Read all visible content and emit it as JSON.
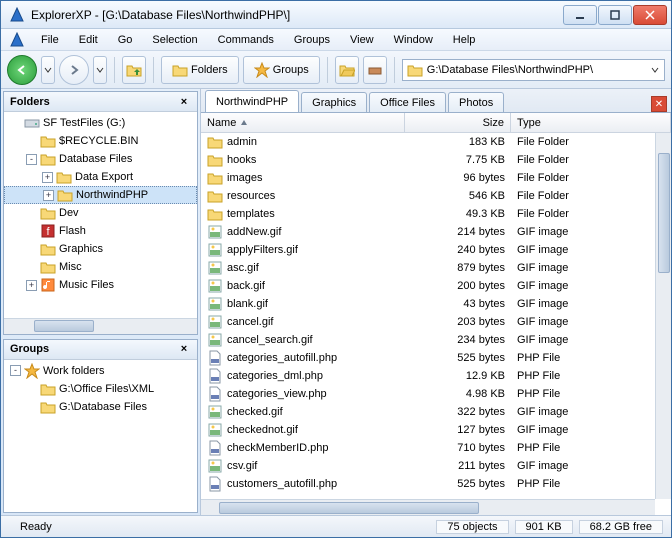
{
  "window": {
    "title": "ExplorerXP - [G:\\Database Files\\NorthwindPHP\\]"
  },
  "menu": [
    "File",
    "Edit",
    "Go",
    "Selection",
    "Commands",
    "Groups",
    "View",
    "Window",
    "Help"
  ],
  "toolbar": {
    "folders": "Folders",
    "groups": "Groups"
  },
  "address": {
    "path": "G:\\Database Files\\NorthwindPHP\\"
  },
  "folders_panel": {
    "title": "Folders",
    "root": "SF TestFiles (G:)",
    "items": [
      {
        "indent": 0,
        "exp": "",
        "icon": "drive",
        "label": "SF TestFiles (G:)"
      },
      {
        "indent": 1,
        "exp": "",
        "icon": "folder",
        "label": "$RECYCLE.BIN"
      },
      {
        "indent": 1,
        "exp": "-",
        "icon": "folder",
        "label": "Database Files"
      },
      {
        "indent": 2,
        "exp": "+",
        "icon": "folder",
        "label": "Data Export"
      },
      {
        "indent": 2,
        "exp": "+",
        "icon": "folder",
        "label": "NorthwindPHP",
        "selected": true
      },
      {
        "indent": 1,
        "exp": "",
        "icon": "folder",
        "label": "Dev"
      },
      {
        "indent": 1,
        "exp": "",
        "icon": "flash",
        "label": "Flash"
      },
      {
        "indent": 1,
        "exp": "",
        "icon": "folder",
        "label": "Graphics"
      },
      {
        "indent": 1,
        "exp": "",
        "icon": "folder",
        "label": "Misc"
      },
      {
        "indent": 1,
        "exp": "+",
        "icon": "music",
        "label": "Music Files"
      }
    ]
  },
  "groups_panel": {
    "title": "Groups",
    "items": [
      {
        "indent": 0,
        "exp": "-",
        "icon": "star",
        "label": "Work folders"
      },
      {
        "indent": 1,
        "exp": "",
        "icon": "folder",
        "label": "G:\\Office Files\\XML"
      },
      {
        "indent": 1,
        "exp": "",
        "icon": "folder",
        "label": "G:\\Database Files"
      }
    ]
  },
  "tabs": [
    "NorthwindPHP",
    "Graphics",
    "Office Files",
    "Photos"
  ],
  "columns": {
    "name": "Name",
    "size": "Size",
    "type": "Type"
  },
  "files": [
    {
      "icon": "folder",
      "name": "admin",
      "size": "183 KB",
      "type": "File Folder"
    },
    {
      "icon": "folder",
      "name": "hooks",
      "size": "7.75 KB",
      "type": "File Folder"
    },
    {
      "icon": "folder",
      "name": "images",
      "size": "96 bytes",
      "type": "File Folder"
    },
    {
      "icon": "folder",
      "name": "resources",
      "size": "546 KB",
      "type": "File Folder"
    },
    {
      "icon": "folder",
      "name": "templates",
      "size": "49.3 KB",
      "type": "File Folder"
    },
    {
      "icon": "gif",
      "name": "addNew.gif",
      "size": "214 bytes",
      "type": "GIF image"
    },
    {
      "icon": "gif",
      "name": "applyFilters.gif",
      "size": "240 bytes",
      "type": "GIF image"
    },
    {
      "icon": "gif",
      "name": "asc.gif",
      "size": "879 bytes",
      "type": "GIF image"
    },
    {
      "icon": "gif",
      "name": "back.gif",
      "size": "200 bytes",
      "type": "GIF image"
    },
    {
      "icon": "gif",
      "name": "blank.gif",
      "size": "43 bytes",
      "type": "GIF image"
    },
    {
      "icon": "gif",
      "name": "cancel.gif",
      "size": "203 bytes",
      "type": "GIF image"
    },
    {
      "icon": "gif",
      "name": "cancel_search.gif",
      "size": "234 bytes",
      "type": "GIF image"
    },
    {
      "icon": "php",
      "name": "categories_autofill.php",
      "size": "525 bytes",
      "type": "PHP File"
    },
    {
      "icon": "php",
      "name": "categories_dml.php",
      "size": "12.9 KB",
      "type": "PHP File"
    },
    {
      "icon": "php",
      "name": "categories_view.php",
      "size": "4.98 KB",
      "type": "PHP File"
    },
    {
      "icon": "gif",
      "name": "checked.gif",
      "size": "322 bytes",
      "type": "GIF image"
    },
    {
      "icon": "gif",
      "name": "checkednot.gif",
      "size": "127 bytes",
      "type": "GIF image"
    },
    {
      "icon": "php",
      "name": "checkMemberID.php",
      "size": "710 bytes",
      "type": "PHP File"
    },
    {
      "icon": "gif",
      "name": "csv.gif",
      "size": "211 bytes",
      "type": "GIF image"
    },
    {
      "icon": "php",
      "name": "customers_autofill.php",
      "size": "525 bytes",
      "type": "PHP File"
    }
  ],
  "status": {
    "ready": "Ready",
    "objects": "75 objects",
    "totalsize": "901 KB",
    "free": "68.2 GB free"
  }
}
